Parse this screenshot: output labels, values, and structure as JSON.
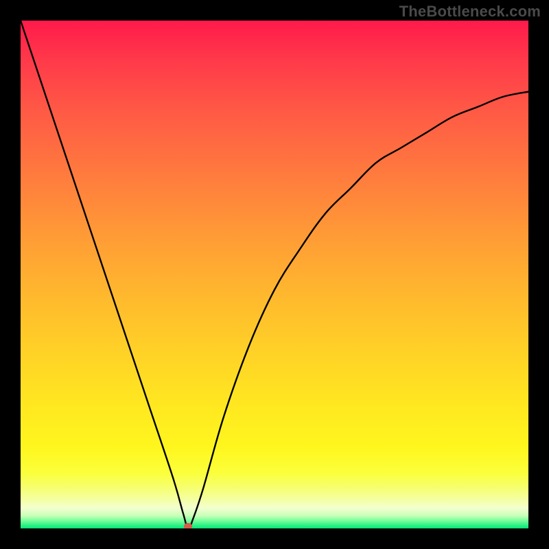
{
  "watermark": "TheBottleneck.com",
  "colors": {
    "frame": "#000000",
    "curve": "#000000",
    "dot": "#d85a4a"
  },
  "chart_data": {
    "type": "line",
    "title": "",
    "xlabel": "",
    "ylabel": "",
    "xlim": [
      0,
      100
    ],
    "ylim": [
      0,
      100
    ],
    "grid": false,
    "legend": false,
    "note": "Background is a smooth vertical red→orange→yellow→pale-yellow→green gradient. A single black curve drops from near (0,100) almost linearly to a sharp minimum near x≈33, y≈0, then rises in a concave curve toward roughly (100,86). A small reddish dot marks the minimum.",
    "series": [
      {
        "name": "curve",
        "x": [
          0,
          5,
          10,
          15,
          20,
          25,
          30,
          32,
          33,
          34,
          36,
          40,
          45,
          50,
          55,
          60,
          65,
          70,
          75,
          80,
          85,
          90,
          95,
          100
        ],
        "y": [
          100,
          85,
          70,
          55,
          40,
          25,
          10,
          3,
          0,
          2,
          8,
          22,
          36,
          47,
          55,
          62,
          67,
          72,
          75,
          78,
          81,
          83,
          85,
          86
        ]
      }
    ],
    "min_point": {
      "x": 33,
      "y": 0
    }
  }
}
